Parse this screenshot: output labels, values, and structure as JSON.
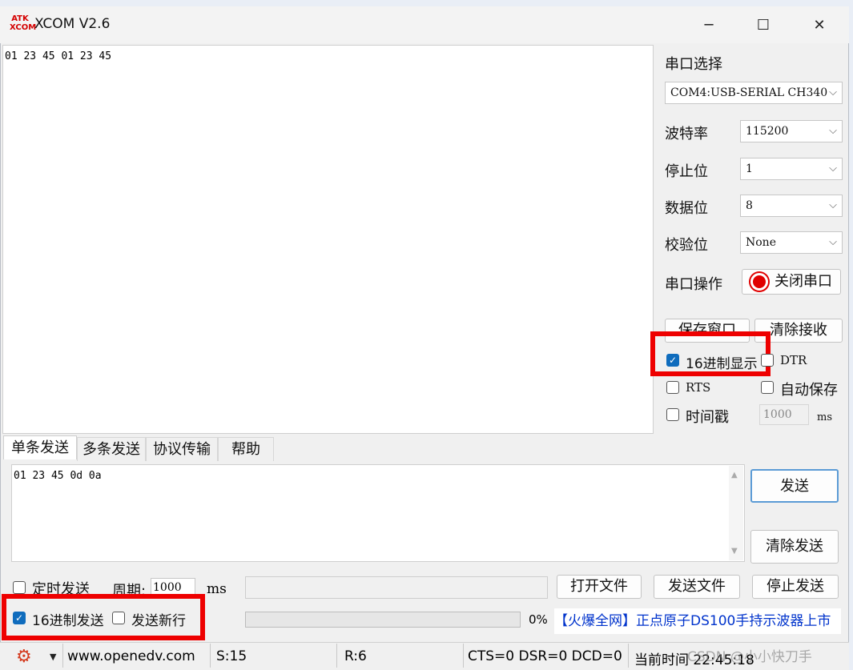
{
  "window": {
    "title": "XCOM V2.6",
    "logo_text": "ATK XCOM",
    "minimize_icon": "─",
    "maximize_icon": "☐",
    "close_icon": "✕"
  },
  "receive": {
    "content": "01 23 45 01 23 45"
  },
  "serial": {
    "port_label": "串口选择",
    "port_value": "COM4:USB-SERIAL CH340",
    "baud_label": "波特率",
    "baud_value": "115200",
    "stop_label": "停止位",
    "stop_value": "1",
    "data_label": "数据位",
    "data_value": "8",
    "parity_label": "校验位",
    "parity_value": "None",
    "op_label": "串口操作",
    "op_button": "关闭串口"
  },
  "receive_options": {
    "save_window": "保存窗口",
    "clear_receive": "清除接收",
    "hex_display": "16进制显示",
    "hex_display_checked": true,
    "dtr": "DTR",
    "rts": "RTS",
    "auto_save": "自动保存",
    "timestamp": "时间戳",
    "timestamp_ms": "1000",
    "ms": "ms"
  },
  "tabs": [
    "单条发送",
    "多条发送",
    "协议传输",
    "帮助"
  ],
  "send": {
    "content": "01 23 45 0d 0a",
    "send_button": "发送",
    "clear_button": "清除发送",
    "timed_send": "定时发送",
    "period_label": "周期:",
    "period_value": "1000",
    "ms": "ms",
    "open_file": "打开文件",
    "send_file": "发送文件",
    "stop_send": "停止发送",
    "hex_send": "16进制发送",
    "hex_send_checked": true,
    "send_newline": "发送新行",
    "progress": "0%",
    "progress_fraction": 0,
    "ad_text": "【火爆全网】正点原子DS100手持示波器上市"
  },
  "status": {
    "website": "www.openedv.com",
    "sent": "S:15",
    "received": "R:6",
    "signals": "CTS=0 DSR=0 DCD=0",
    "time": "当前时间 22:45:18",
    "watermark": "CSDN @小小快刀手"
  },
  "colors": {
    "highlight": "#ee0000",
    "ad_blue": "#0033cc",
    "checkbox_blue": "#0f6cbd",
    "gear_red": "#d43b1f"
  }
}
